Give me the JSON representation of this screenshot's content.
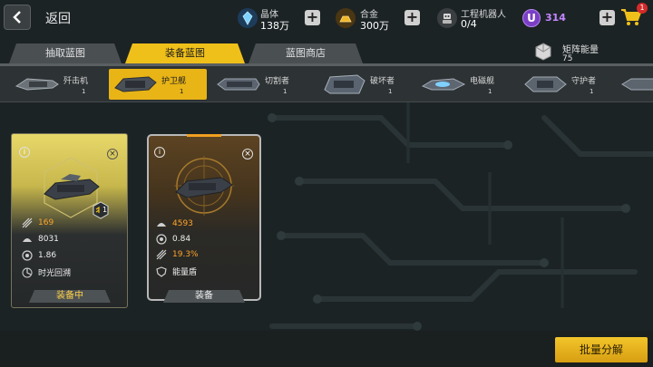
{
  "topbar": {
    "back_label": "返回",
    "resources": [
      {
        "name": "晶体",
        "value": "138万",
        "icon": "crystal-icon"
      },
      {
        "name": "合金",
        "value": "300万",
        "icon": "alloy-icon"
      },
      {
        "name": "工程机器人",
        "value": "0/4",
        "icon": "robot-icon"
      }
    ],
    "premium": {
      "symbol": "U",
      "value": "314"
    },
    "cart_badge": "1"
  },
  "tabs": [
    {
      "label": "抽取蓝图",
      "active": false
    },
    {
      "label": "装备蓝图",
      "active": true
    },
    {
      "label": "蓝图商店",
      "active": false
    }
  ],
  "matrix_energy": {
    "label": "矩阵能量",
    "value": "75"
  },
  "ships": [
    {
      "name": "歼击机",
      "count": "1",
      "selected": false
    },
    {
      "name": "护卫舰",
      "count": "1",
      "selected": true
    },
    {
      "name": "切割者",
      "count": "1",
      "selected": false
    },
    {
      "name": "破坏者",
      "count": "1",
      "selected": false
    },
    {
      "name": "电磁舰",
      "count": "1",
      "selected": false
    },
    {
      "name": "守护者",
      "count": "1",
      "selected": false
    }
  ],
  "cards": [
    {
      "stats": [
        "169",
        "8031",
        "1.86"
      ],
      "skill": "时光回溯",
      "rank": "1",
      "button": "装备中"
    },
    {
      "stats": [
        "4593",
        "0.84",
        "19.3%"
      ],
      "skill": "能量盾",
      "button": "装备"
    }
  ],
  "batch_button": "批量分解",
  "colors": {
    "accent": "#f0c01a",
    "premium": "#c386ff",
    "stat_highlight": "#ffa52a"
  }
}
